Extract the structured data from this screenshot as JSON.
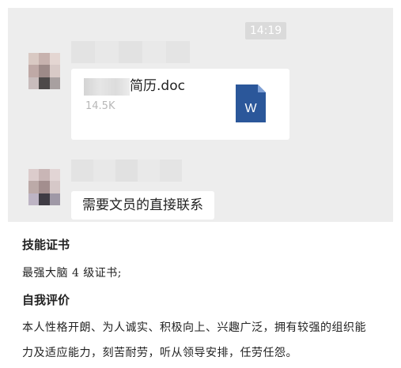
{
  "chat": {
    "timestamp": "14:19",
    "file_message": {
      "file_name": "简历.doc",
      "file_size": "14.5K",
      "file_icon": "word-doc-icon",
      "icon_color": "#2b579a",
      "icon_letter": "W"
    },
    "text_message": "需要文员的直接联系"
  },
  "resume": {
    "skills_heading": "技能证书",
    "skills_text": "最强大脑 4 级证书;",
    "self_eval_heading": "自我评价",
    "self_eval_line1": "本人性格开朗、为人诚实、积极向上、兴趣广泛，拥有较强的组织能",
    "self_eval_line2": "力及适应能力，刻苦耐劳，听从领导安排，任劳任怨。"
  }
}
